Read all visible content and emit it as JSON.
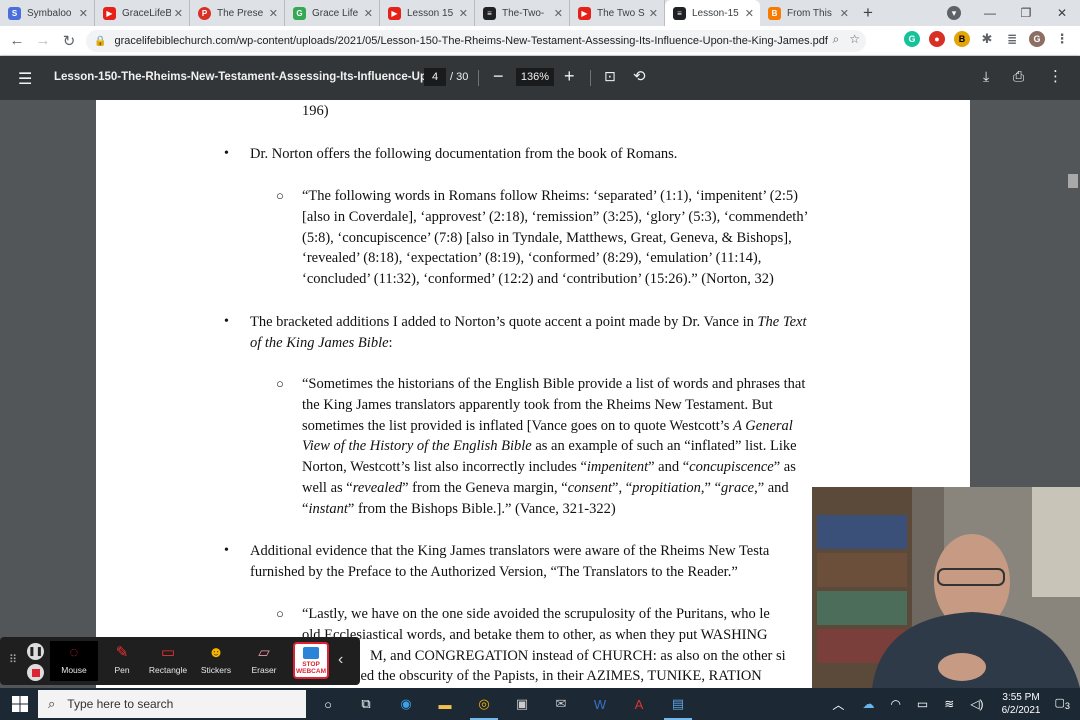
{
  "browser": {
    "tabs": [
      {
        "title": "Symbaloo",
        "color": "#4a6fdc",
        "icon": "symbaloo-icon"
      },
      {
        "title": "GraceLifeB",
        "color": "#e62117",
        "icon": "youtube-icon"
      },
      {
        "title": "The Prese",
        "color": "#d93025",
        "icon": "presentation-icon"
      },
      {
        "title": "Grace Life",
        "color": "#34a853",
        "icon": "gracelife-icon"
      },
      {
        "title": "Lesson 15",
        "color": "#e62117",
        "icon": "youtube-icon"
      },
      {
        "title": "The-Two-",
        "color": "#202124",
        "icon": "document-icon"
      },
      {
        "title": "The Two S",
        "color": "#e62117",
        "icon": "youtube-icon"
      },
      {
        "title": "Lesson-15",
        "color": "#202124",
        "icon": "document-icon",
        "active": true
      },
      {
        "title": "From This",
        "color": "#f57c00",
        "icon": "blogger-icon"
      }
    ],
    "new_tab": "+",
    "url": "gracelifebiblechurch.com/wp-content/uploads/2021/05/Lesson-150-The-Rheims-New-Testament-Assessing-Its-Influence-Upon-the-King-James.pdf",
    "profile_initial": "G"
  },
  "pdf": {
    "title": "Lesson-150-The-Rheims-New-Testament-Assessing-Its-Influence-Upo...",
    "page_current": "4",
    "page_total": "/ 30",
    "zoom": "136%"
  },
  "doc": {
    "top_line": "196)",
    "b1": "Dr. Norton offers the following documentation from the book of Romans.",
    "q1": [
      "“The following words in Romans follow Rheims: ‘separated’ (1:1), ‘impenitent’ (2:5)",
      "[also in Coverdale], ‘approvest’ (2:18), ‘remission” (3:25), ‘glory’ (5:3), ‘commendeth’",
      "(5:8), ‘concupiscence’ (7:8) [also in Tyndale, Matthews, Great, Geneva, & Bishops],",
      "‘revealed’ (8:18), ‘expectation’ (8:19), ‘conformed’ (8:29), ‘emulation’ (11:14),",
      "‘concluded’ (11:32), ‘conformed’ (12:2) and ‘contribution’ (15:26).” (Norton, 32)"
    ],
    "b2_a": "The bracketed additions I added to Norton’s quote accent a point made by Dr. Vance in ",
    "b2_ital1": "The Text",
    "b2_ital2": "of the King James Bible",
    "b2_end": ":",
    "q2": {
      "l1": "“Sometimes the historians of the English Bible provide a list of words and phrases that",
      "l2": "the King James translators apparently took from the Rheims New Testament.  But",
      "l3a": "sometimes the list provided is inflated [Vance goes on to quote Westcott’s ",
      "l3i": "A General",
      "l4i": "View of the History of the English Bible",
      "l4b": " as an example of such an “inflated” list.  Like",
      "l5a": "Norton, Westcott’s list also incorrectly includes “",
      "l5i1": "impenitent",
      "l5b": "” and “",
      "l5i2": "concupiscence",
      "l5c": "” as",
      "l6a": "well as “",
      "l6i1": "revealed",
      "l6b": "” from the Geneva margin, “",
      "l6i2": "consent",
      "l6c": "”, “",
      "l6i3": "propitiation",
      "l6d": ",” “",
      "l6i4": "grace",
      "l6e": ",” and",
      "l7a": "“",
      "l7i": "instant",
      "l7b": "” from the Bishops Bible.].” (Vance, 321-322)"
    },
    "b3_l1": "Additional evidence that the King James translators were aware of the Rheims New Testa",
    "b3_l2": "furnished by the Preface to the Authorized Version, “The Translators to the Reader.”",
    "q3": [
      "“Lastly, we have on the one side avoided the scrupulosity of the Puritans, who le",
      "old Ecclesiastical words, and betake them to other, as when they put WASHING",
      "M, and CONGREGATION instead of CHURCH: as also on the other si",
      "nned the obscurity of the Papists, in their AZIMES, TUNIKE, RATION"
    ]
  },
  "recorder": {
    "tools": [
      {
        "label": "Mouse",
        "icon": "mouse-icon"
      },
      {
        "label": "Pen",
        "icon": "pen-icon"
      },
      {
        "label": "Rectangle",
        "icon": "rectangle-icon"
      },
      {
        "label": "Stickers",
        "icon": "sticker-icon"
      },
      {
        "label": "Eraser",
        "icon": "eraser-icon"
      }
    ],
    "stop_webcam": "STOP WEBCAM"
  },
  "taskbar": {
    "search_placeholder": "Type here to search",
    "time": "3:55 PM",
    "date": "6/2/2021",
    "notifications": "3"
  }
}
